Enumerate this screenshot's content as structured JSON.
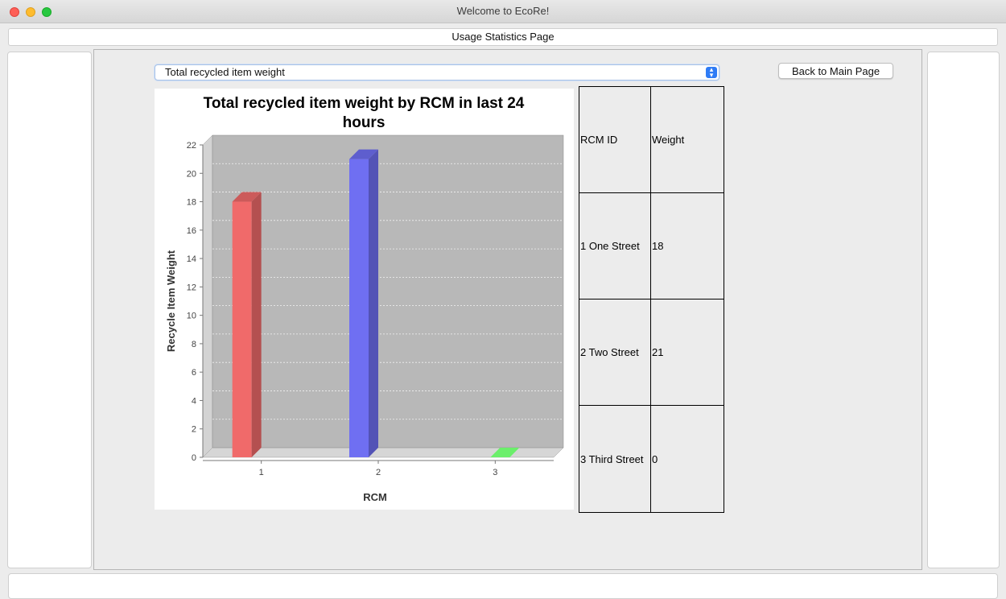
{
  "window": {
    "title": "Welcome to EcoRe!"
  },
  "page": {
    "header": "Usage Statistics Page"
  },
  "controls": {
    "stat_select": "Total recycled item weight",
    "back_button": "Back to Main Page"
  },
  "table": {
    "headers": [
      "RCM ID",
      "Weight"
    ],
    "rows": [
      [
        "1 One Street",
        "18"
      ],
      [
        "2 Two Street",
        "21"
      ],
      [
        "3 Third Street",
        "0"
      ]
    ]
  },
  "chart_data": {
    "type": "bar",
    "title": "Total recycled item weight by RCM in last 24 hours",
    "title_lines": [
      "Total recycled item weight by RCM in last 24",
      "hours"
    ],
    "xlabel": "RCM",
    "ylabel": "Recycle Item Weight",
    "categories": [
      "1",
      "2",
      "3"
    ],
    "values": [
      18,
      21,
      0
    ],
    "ylim": [
      0,
      22
    ],
    "yticks": [
      0,
      2,
      4,
      6,
      8,
      10,
      12,
      14,
      16,
      18,
      20,
      22
    ],
    "grid": true,
    "colors": [
      "#f06a6a",
      "#6f6ff2",
      "#6bef6b"
    ],
    "plot_background": "#b8b8b8"
  }
}
